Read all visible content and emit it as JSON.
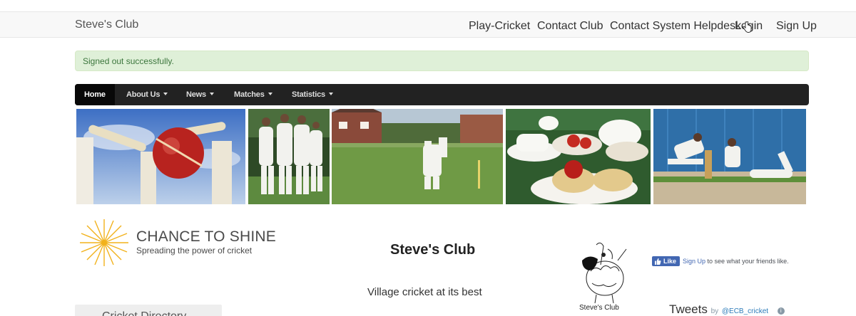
{
  "topbar": {
    "brand": "Steve's Club",
    "links": {
      "play_cricket": "Play-Cricket",
      "contact_club": "Contact Club",
      "helpdesk": "Contact System Helpdesk",
      "login": "Login",
      "signup": "Sign Up"
    }
  },
  "alert": {
    "message": "Signed out successfully."
  },
  "nav": {
    "home": "Home",
    "about": "About Us",
    "news": "News",
    "matches": "Matches",
    "statistics": "Statistics"
  },
  "banner": {
    "images": [
      "ball-hitting-stumps-photo",
      "team-celebrating-photo",
      "village-match-photo",
      "cream-tea-photo",
      "indoor-cricket-photo"
    ]
  },
  "chance_to_shine": {
    "title": "CHANCE TO SHINE",
    "subtitle": "Spreading the power of cricket"
  },
  "main": {
    "club_title": "Steve's Club",
    "tagline": "Village cricket at its best"
  },
  "crest": {
    "label": "Steve's Club"
  },
  "facebook": {
    "like_label": "Like",
    "signup_link": "Sign Up",
    "text": " to see what your friends like."
  },
  "twitter": {
    "title": "Tweets",
    "by": "by",
    "handle": "@ECB_cricket"
  },
  "sidebar": {
    "directory_title": "Cricket Directory"
  },
  "colors": {
    "navbar_bg": "#222222",
    "alert_bg": "#dff0d8",
    "alert_text": "#3c763d",
    "facebook_blue": "#4267b2"
  }
}
